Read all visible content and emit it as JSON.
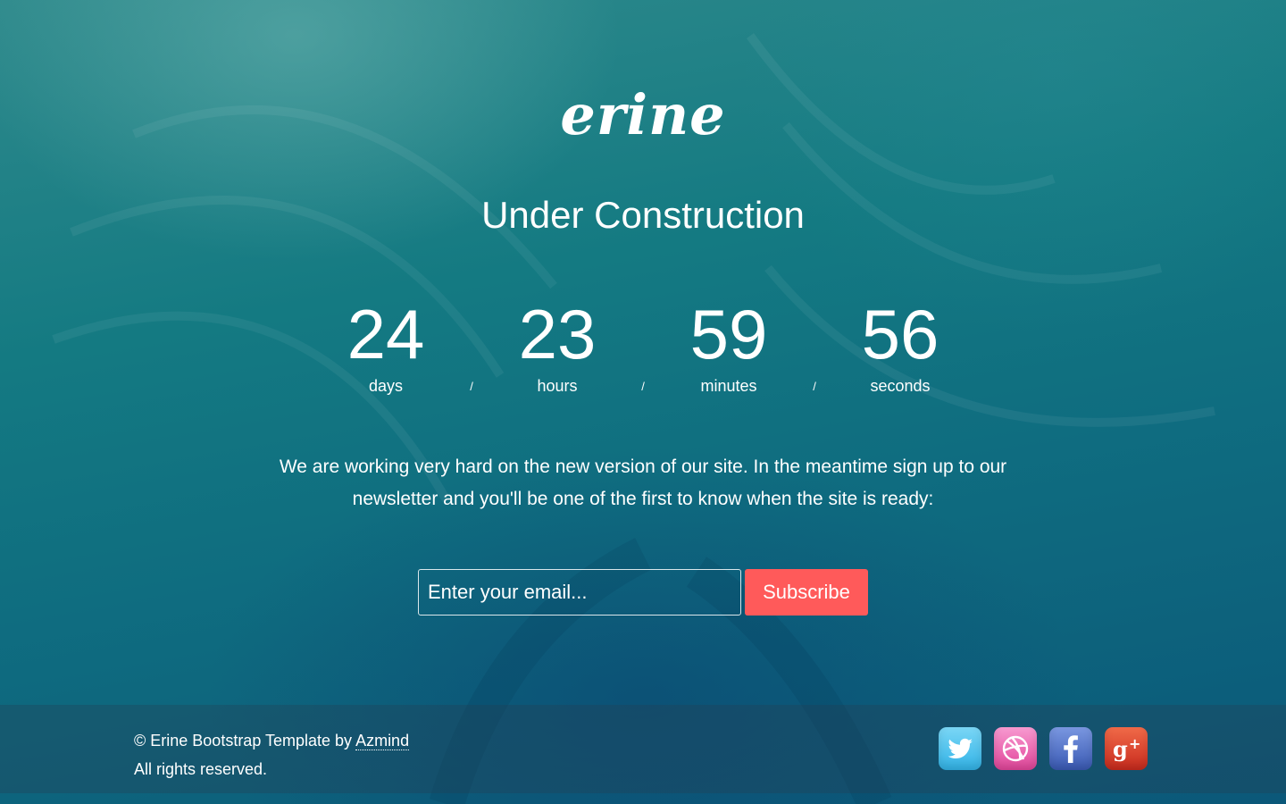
{
  "logo": "erine",
  "headline": "Under Construction",
  "countdown": {
    "days": {
      "value": "24",
      "label": "days"
    },
    "hours": {
      "value": "23",
      "label": "hours"
    },
    "minutes": {
      "value": "59",
      "label": "minutes"
    },
    "seconds": {
      "value": "56",
      "label": "seconds"
    },
    "separator": "/"
  },
  "message": "We are working very hard on the new version of our site. In the meantime sign up to our newsletter and you'll be one of the first to know when the site is ready:",
  "form": {
    "email_placeholder": "Enter your email...",
    "subscribe_label": "Subscribe"
  },
  "footer": {
    "copyright_prefix": "© Erine Bootstrap Template by ",
    "author_link": "Azmind",
    "rights": "All rights reserved."
  },
  "social": [
    "twitter-icon",
    "dribbble-icon",
    "facebook-icon",
    "google-plus-icon"
  ],
  "colors": {
    "accent_button": "#ff5a5a",
    "text": "#ffffff",
    "background": "#147a82"
  }
}
